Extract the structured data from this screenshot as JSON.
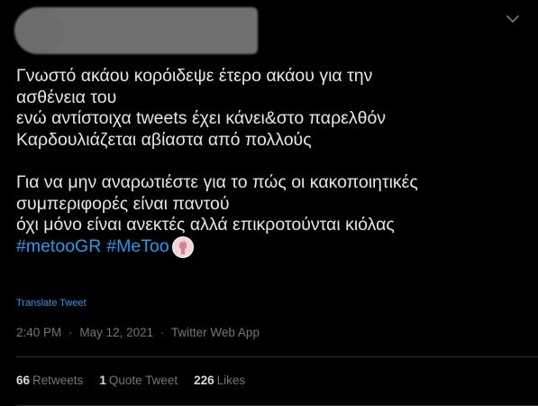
{
  "tweet": {
    "lines": [
      "Γνωστό ακάου κορόιδεψε έτερο ακάου για την",
      "ασθένεια του",
      "ενώ αντίστοιχα tweets έχει κάνει&στο παρελθόν",
      "Καρδουλιάζεται αβίαστα από πολλούς",
      "Για να μην αναρωτιέστε για το πώς οι κακοποιητικές",
      "συμπεριφορές είναι παντού",
      "όχι μόνο είναι ανεκτές αλλά επικροτούνται κιόλας"
    ],
    "hashtags": [
      "#metooGR",
      "#MeToo"
    ],
    "emoji_icon": "raised-fist-emoji-icon"
  },
  "translate_label": "Translate Tweet",
  "meta": {
    "time": "2:40 PM",
    "separator": "·",
    "date": "May 12, 2021",
    "source": "Twitter Web App"
  },
  "stats": {
    "retweets_count": "66",
    "retweets_label": "Retweets",
    "quotes_count": "1",
    "quotes_label": "Quote Tweet",
    "likes_count": "226",
    "likes_label": "Likes"
  },
  "colors": {
    "background": "#000000",
    "text": "#e6e6e6",
    "link": "#1d9bf0",
    "secondary": "#6e767d",
    "divider": "#2f3336"
  }
}
